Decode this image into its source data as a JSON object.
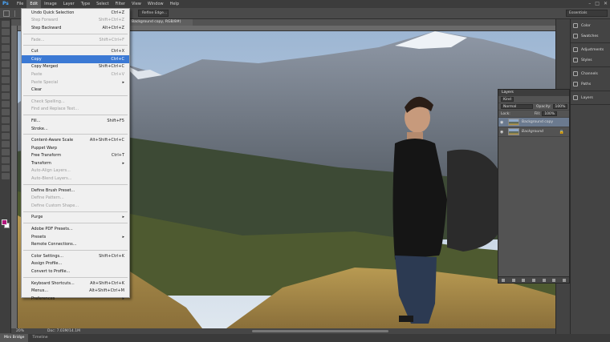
{
  "app": {
    "logo": "Ps",
    "menus": [
      "File",
      "Edit",
      "Image",
      "Layer",
      "Type",
      "Select",
      "Filter",
      "View",
      "Window",
      "Help"
    ],
    "window_controls": [
      "–",
      "□",
      "✕"
    ]
  },
  "options_bar": {
    "refine_edge": "Refine Edge...",
    "workspace": "Essentials"
  },
  "document": {
    "tab_label": "Background copy, RGB/8#)",
    "zoom": "20%",
    "doc_size": "Doc: 7.03M/14.1M"
  },
  "edit_menu": [
    {
      "label": "Undo Quick Selection",
      "shortcut": "Ctrl+Z",
      "disabled": false
    },
    {
      "label": "Step Forward",
      "shortcut": "Shift+Ctrl+Z",
      "disabled": true
    },
    {
      "label": "Step Backward",
      "shortcut": "Alt+Ctrl+Z",
      "disabled": false
    },
    {
      "sep": true
    },
    {
      "label": "Fade...",
      "shortcut": "Shift+Ctrl+F",
      "disabled": true
    },
    {
      "sep": true
    },
    {
      "label": "Cut",
      "shortcut": "Ctrl+X",
      "disabled": false
    },
    {
      "label": "Copy",
      "shortcut": "Ctrl+C",
      "disabled": false,
      "highlighted": true
    },
    {
      "label": "Copy Merged",
      "shortcut": "Shift+Ctrl+C",
      "disabled": false
    },
    {
      "label": "Paste",
      "shortcut": "Ctrl+V",
      "disabled": true
    },
    {
      "label": "Paste Special",
      "shortcut": "",
      "disabled": true,
      "submenu": true
    },
    {
      "label": "Clear",
      "shortcut": "",
      "disabled": false
    },
    {
      "sep": true
    },
    {
      "label": "Check Spelling...",
      "shortcut": "",
      "disabled": true
    },
    {
      "label": "Find and Replace Text...",
      "shortcut": "",
      "disabled": true
    },
    {
      "sep": true
    },
    {
      "label": "Fill...",
      "shortcut": "Shift+F5",
      "disabled": false
    },
    {
      "label": "Stroke...",
      "shortcut": "",
      "disabled": false
    },
    {
      "sep": true
    },
    {
      "label": "Content-Aware Scale",
      "shortcut": "Alt+Shift+Ctrl+C",
      "disabled": false
    },
    {
      "label": "Puppet Warp",
      "shortcut": "",
      "disabled": false
    },
    {
      "label": "Free Transform",
      "shortcut": "Ctrl+T",
      "disabled": false
    },
    {
      "label": "Transform",
      "shortcut": "",
      "disabled": false,
      "submenu": true
    },
    {
      "label": "Auto-Align Layers...",
      "shortcut": "",
      "disabled": true
    },
    {
      "label": "Auto-Blend Layers...",
      "shortcut": "",
      "disabled": true
    },
    {
      "sep": true
    },
    {
      "label": "Define Brush Preset...",
      "shortcut": "",
      "disabled": false
    },
    {
      "label": "Define Pattern...",
      "shortcut": "",
      "disabled": true
    },
    {
      "label": "Define Custom Shape...",
      "shortcut": "",
      "disabled": true
    },
    {
      "sep": true
    },
    {
      "label": "Purge",
      "shortcut": "",
      "disabled": false,
      "submenu": true
    },
    {
      "sep": true
    },
    {
      "label": "Adobe PDF Presets...",
      "shortcut": "",
      "disabled": false
    },
    {
      "label": "Presets",
      "shortcut": "",
      "disabled": false,
      "submenu": true
    },
    {
      "label": "Remote Connections...",
      "shortcut": "",
      "disabled": false
    },
    {
      "sep": true
    },
    {
      "label": "Color Settings...",
      "shortcut": "Shift+Ctrl+K",
      "disabled": false
    },
    {
      "label": "Assign Profile...",
      "shortcut": "",
      "disabled": false
    },
    {
      "label": "Convert to Profile...",
      "shortcut": "",
      "disabled": false
    },
    {
      "sep": true
    },
    {
      "label": "Keyboard Shortcuts...",
      "shortcut": "Alt+Shift+Ctrl+K",
      "disabled": false
    },
    {
      "label": "Menus...",
      "shortcut": "Alt+Shift+Ctrl+M",
      "disabled": false
    },
    {
      "label": "Preferences",
      "shortcut": "",
      "disabled": false,
      "submenu": true
    }
  ],
  "dock": {
    "groups": [
      [
        "Color",
        "Swatches"
      ],
      [
        "Adjustments",
        "Styles"
      ],
      [
        "Channels",
        "Paths"
      ],
      [
        "Layers"
      ]
    ]
  },
  "layers_panel": {
    "title": "Layers",
    "filter": "Kind",
    "blend_mode": "Normal",
    "opacity_label": "Opacity:",
    "opacity_value": "100%",
    "lock_label": "Lock:",
    "fill_label": "Fill:",
    "fill_value": "100%",
    "layers": [
      {
        "name": "Background copy",
        "selected": true,
        "locked": false
      },
      {
        "name": "Background",
        "selected": false,
        "locked": true
      }
    ]
  },
  "bottom_tabs": [
    "Mini Bridge",
    "Timeline"
  ]
}
